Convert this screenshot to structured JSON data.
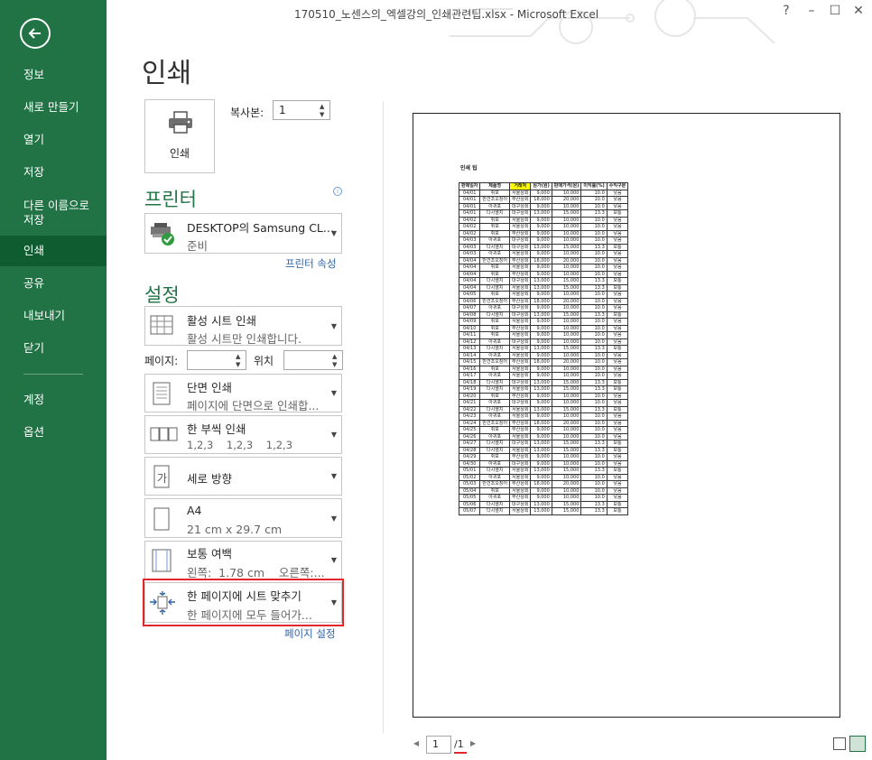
{
  "window": {
    "title": "170510_노센스의_엑셀강의_인쇄관련팁.xlsx - Microsoft Excel",
    "help": "?",
    "minimize": "–",
    "restore": "☐",
    "close": "✕"
  },
  "nav": {
    "back_icon": "back-arrow-icon",
    "items": [
      {
        "label": "정보"
      },
      {
        "label": "새로 만들기"
      },
      {
        "label": "열기"
      },
      {
        "label": "저장"
      },
      {
        "label": "다른 이름으로\n저장"
      },
      {
        "label": "인쇄",
        "active": true
      },
      {
        "label": "공유"
      },
      {
        "label": "내보내기"
      },
      {
        "label": "닫기"
      },
      {
        "label": "계정"
      },
      {
        "label": "옵션"
      }
    ]
  },
  "print": {
    "heading": "인쇄",
    "button_label": "인쇄",
    "copies_label": "복사본:",
    "copies_value": "1"
  },
  "printer": {
    "section_title": "프린터",
    "info_icon": "ⓘ",
    "name": "DESKTOP의 Samsung CL...",
    "status": "준비",
    "properties_link": "프린터 속성"
  },
  "settings": {
    "section_title": "설정",
    "what": {
      "line1": "활성 시트 인쇄",
      "line2": "활성 시트만 인쇄합니다."
    },
    "pages_label": "페이지:",
    "to_label": "위치",
    "sides": {
      "line1": "단면 인쇄",
      "line2": "페이지에 단면으로 인쇄합..."
    },
    "collate": {
      "line1": "한 부씩 인쇄",
      "line2": "1,2,3    1,2,3    1,2,3"
    },
    "orientation": {
      "line1": "세로 방향"
    },
    "paper": {
      "line1": "A4",
      "line2": "21 cm x 29.7 cm"
    },
    "margins": {
      "line1": "보통 여백",
      "line2": "왼쪽:  1.78 cm    오른쪽:..."
    },
    "scaling": {
      "line1": "한 페이지에 시트 맞추기",
      "line2": "한 페이지에 모두 들어가..."
    },
    "page_setup_link": "페이지 설정"
  },
  "preview": {
    "sheet_title": "인쇄 팁",
    "headers": [
      "판매일자",
      "제품명",
      "거래처",
      "원가(원)",
      "판매가격(원)",
      "이익률(%)",
      "수익구분"
    ],
    "rows": [
      [
        "04/01",
        "쥐포",
        "서울상회",
        "9,000",
        "10,000",
        "10.0",
        "낮음"
      ],
      [
        "04/01",
        "반건조오징어",
        "부산상회",
        "18,000",
        "20,000",
        "10.0",
        "낮음"
      ],
      [
        "04/01",
        "아귀포",
        "대구상회",
        "9,000",
        "10,000",
        "10.0",
        "낮음"
      ],
      [
        "04/01",
        "다시멸치",
        "대구상회",
        "13,000",
        "15,000",
        "13.3",
        "보통"
      ],
      [
        "04/02",
        "쥐포",
        "서울상회",
        "9,000",
        "10,000",
        "10.0",
        "낮음"
      ],
      [
        "04/02",
        "쥐포",
        "서울상회",
        "9,000",
        "10,000",
        "10.0",
        "낮음"
      ],
      [
        "04/02",
        "쥐포",
        "부산상회",
        "9,000",
        "10,000",
        "10.0",
        "낮음"
      ],
      [
        "04/03",
        "아귀포",
        "대구상회",
        "9,000",
        "10,000",
        "10.0",
        "낮음"
      ],
      [
        "04/03",
        "다시멸치",
        "대구상회",
        "13,000",
        "15,000",
        "13.3",
        "보통"
      ],
      [
        "04/03",
        "아귀포",
        "서울상회",
        "9,000",
        "10,000",
        "10.0",
        "낮음"
      ],
      [
        "04/04",
        "반건조오징어",
        "부산상회",
        "18,000",
        "20,000",
        "10.0",
        "낮음"
      ],
      [
        "04/04",
        "쥐포",
        "서울상회",
        "9,000",
        "10,000",
        "10.0",
        "낮음"
      ],
      [
        "04/04",
        "쥐포",
        "부산상회",
        "9,000",
        "10,000",
        "10.0",
        "낮음"
      ],
      [
        "04/04",
        "다시멸치",
        "대구상회",
        "13,000",
        "15,000",
        "13.3",
        "보통"
      ],
      [
        "04/04",
        "다시멸치",
        "서울상회",
        "13,000",
        "15,000",
        "13.3",
        "보통"
      ],
      [
        "04/05",
        "쥐포",
        "서울상회",
        "9,000",
        "10,000",
        "10.0",
        "낮음"
      ],
      [
        "04/06",
        "반건조오징어",
        "부산상회",
        "18,000",
        "20,000",
        "10.0",
        "낮음"
      ],
      [
        "04/07",
        "아귀포",
        "대구상회",
        "9,000",
        "10,000",
        "10.0",
        "낮음"
      ],
      [
        "04/08",
        "다시멸치",
        "대구상회",
        "13,000",
        "15,000",
        "13.3",
        "보통"
      ],
      [
        "04/09",
        "쥐포",
        "서울상회",
        "9,000",
        "10,000",
        "10.0",
        "낮음"
      ],
      [
        "04/10",
        "쥐포",
        "부산상회",
        "9,000",
        "10,000",
        "10.0",
        "낮음"
      ],
      [
        "04/11",
        "쥐포",
        "서울상회",
        "9,000",
        "10,000",
        "10.0",
        "낮음"
      ],
      [
        "04/12",
        "아귀포",
        "대구상회",
        "9,000",
        "10,000",
        "10.0",
        "낮음"
      ],
      [
        "04/13",
        "다시멸치",
        "서울상회",
        "13,000",
        "15,000",
        "13.3",
        "보통"
      ],
      [
        "04/14",
        "아귀포",
        "서울상회",
        "9,000",
        "10,000",
        "10.0",
        "낮음"
      ],
      [
        "04/15",
        "반건조오징어",
        "부산상회",
        "18,000",
        "20,000",
        "10.0",
        "낮음"
      ],
      [
        "04/16",
        "쥐포",
        "서울상회",
        "9,000",
        "10,000",
        "10.0",
        "낮음"
      ],
      [
        "04/17",
        "아귀포",
        "서울상회",
        "9,000",
        "10,000",
        "10.0",
        "낮음"
      ],
      [
        "04/18",
        "다시멸치",
        "대구상회",
        "13,000",
        "15,000",
        "13.3",
        "보통"
      ],
      [
        "04/19",
        "다시멸치",
        "서울상회",
        "13,000",
        "15,000",
        "13.3",
        "보통"
      ],
      [
        "04/20",
        "쥐포",
        "부산상회",
        "9,000",
        "10,000",
        "10.0",
        "낮음"
      ],
      [
        "04/21",
        "아귀포",
        "대구상회",
        "9,000",
        "10,000",
        "10.0",
        "낮음"
      ],
      [
        "04/22",
        "다시멸치",
        "서울상회",
        "13,000",
        "15,000",
        "13.3",
        "보통"
      ],
      [
        "04/23",
        "아귀포",
        "서울상회",
        "9,000",
        "10,000",
        "10.0",
        "낮음"
      ],
      [
        "04/24",
        "반건조오징어",
        "부산상회",
        "18,000",
        "20,000",
        "10.0",
        "낮음"
      ],
      [
        "04/25",
        "쥐포",
        "부산상회",
        "9,000",
        "10,000",
        "10.0",
        "낮음"
      ],
      [
        "04/26",
        "아귀포",
        "서울상회",
        "9,000",
        "10,000",
        "10.0",
        "낮음"
      ],
      [
        "04/27",
        "다시멸치",
        "대구상회",
        "13,000",
        "15,000",
        "13.3",
        "보통"
      ],
      [
        "04/28",
        "다시멸치",
        "서울상회",
        "13,000",
        "15,000",
        "13.3",
        "보통"
      ],
      [
        "04/29",
        "쥐포",
        "부산상회",
        "9,000",
        "10,000",
        "10.0",
        "낮음"
      ],
      [
        "04/30",
        "아귀포",
        "대구상회",
        "9,000",
        "10,000",
        "10.0",
        "낮음"
      ],
      [
        "05/01",
        "다시멸치",
        "서울상회",
        "13,000",
        "15,000",
        "13.3",
        "보통"
      ],
      [
        "05/02",
        "아귀포",
        "서울상회",
        "9,000",
        "10,000",
        "10.0",
        "낮음"
      ],
      [
        "05/03",
        "반건조오징어",
        "부산상회",
        "18,000",
        "20,000",
        "10.0",
        "낮음"
      ],
      [
        "05/04",
        "쥐포",
        "서울상회",
        "9,000",
        "10,000",
        "10.0",
        "낮음"
      ],
      [
        "05/05",
        "아귀포",
        "부산상회",
        "9,000",
        "10,000",
        "10.0",
        "낮음"
      ],
      [
        "05/06",
        "다시멸치",
        "대구상회",
        "13,000",
        "15,000",
        "13.3",
        "보통"
      ],
      [
        "05/07",
        "다시멸치",
        "서울상회",
        "13,000",
        "15,000",
        "13.3",
        "보통"
      ]
    ]
  },
  "pager": {
    "prev": "◀",
    "current": "1",
    "total": "/1",
    "next": "▶"
  },
  "colors": {
    "accent": "#217346",
    "highlight": "#e3262d",
    "header_fill": "#ffff00"
  }
}
